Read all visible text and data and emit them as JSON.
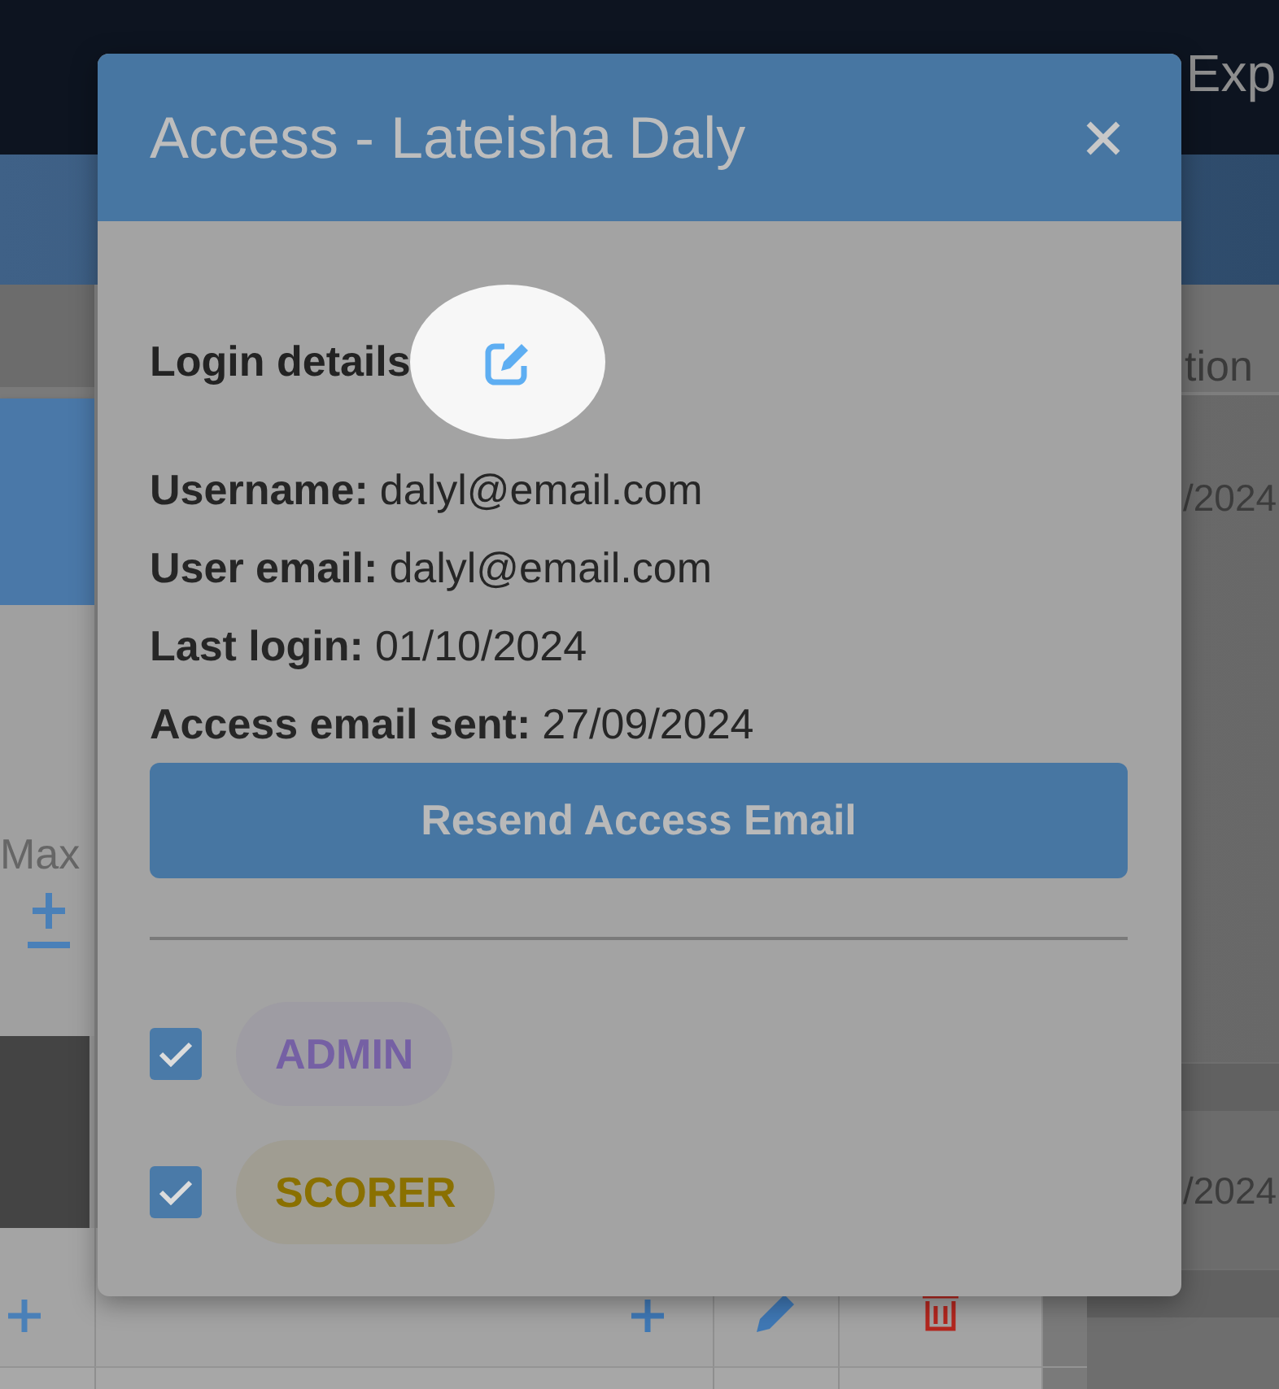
{
  "top_bar": {
    "action": "Exp"
  },
  "side_panel": {
    "label": "Max"
  },
  "table": {
    "column_heading": "tion",
    "cells": [
      "/2024",
      "/2024"
    ]
  },
  "dialog": {
    "title": "Access - Lateisha Daly",
    "section_title": "Login details",
    "details": [
      {
        "label": "Username:",
        "value": "dalyl@email.com"
      },
      {
        "label": "User email:",
        "value": "dalyl@email.com"
      },
      {
        "label": "Last login:",
        "value": "01/10/2024"
      },
      {
        "label": "Access email sent:",
        "value": "27/09/2024"
      }
    ],
    "resend_button": "Resend Access Email",
    "roles": [
      {
        "label": "ADMIN",
        "checked": true,
        "color": "#7560a4"
      },
      {
        "label": "SCORER",
        "checked": true,
        "color": "#8a7000"
      }
    ]
  }
}
